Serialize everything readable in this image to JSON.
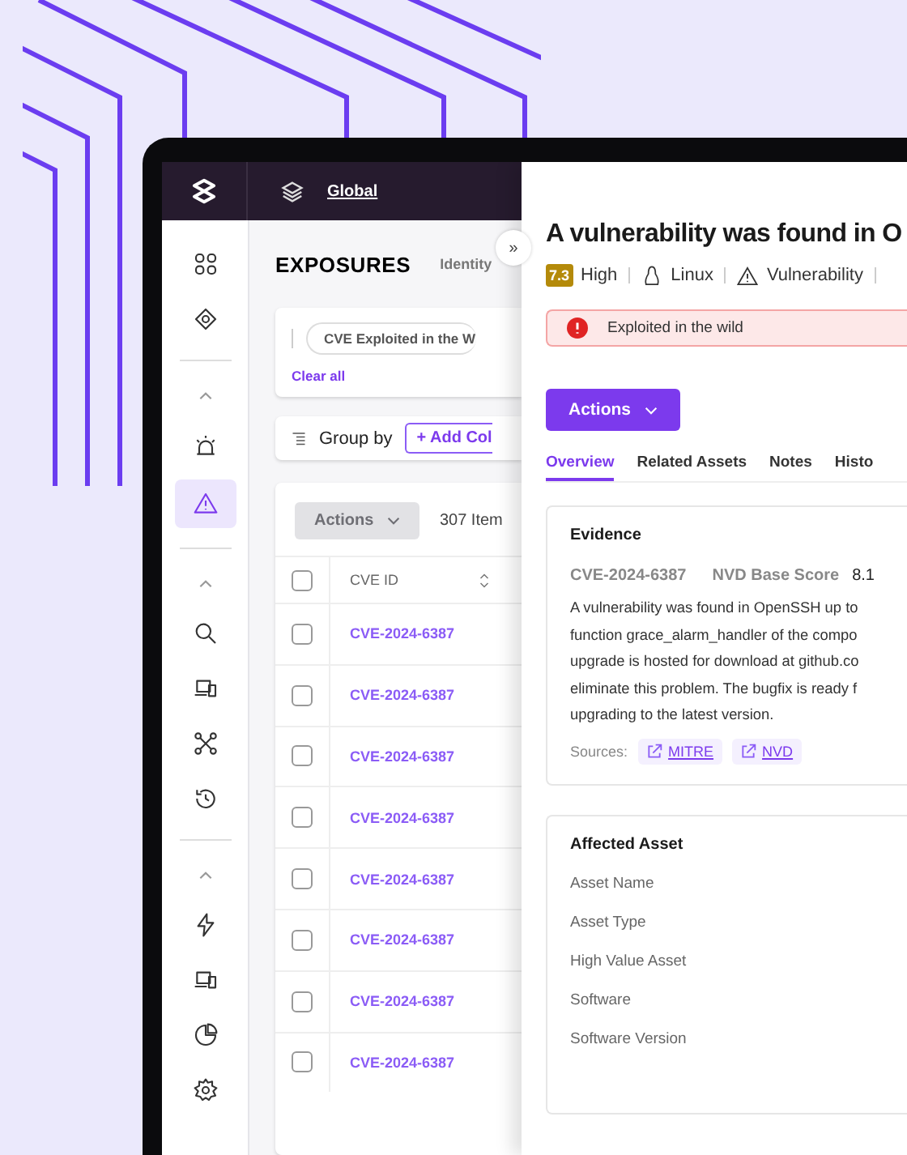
{
  "top_bar": {
    "scope": "Global"
  },
  "sidebar": {
    "sections": [
      {
        "items": [
          {
            "kind": "grid",
            "selected": false
          },
          {
            "kind": "drone",
            "selected": false
          }
        ]
      },
      {
        "expanded": true,
        "items": [
          {
            "kind": "alarm",
            "selected": false
          },
          {
            "kind": "warning",
            "selected": true
          }
        ]
      },
      {
        "expanded": true,
        "items": [
          {
            "kind": "search",
            "selected": false
          },
          {
            "kind": "devices",
            "selected": false
          },
          {
            "kind": "network",
            "selected": false
          },
          {
            "kind": "history",
            "selected": false
          }
        ]
      },
      {
        "expanded": true,
        "items": [
          {
            "kind": "bolt",
            "selected": false
          },
          {
            "kind": "devices",
            "selected": false
          },
          {
            "kind": "pie",
            "selected": false
          },
          {
            "kind": "gear",
            "selected": false
          }
        ]
      }
    ]
  },
  "header": {
    "title": "EXPOSURES",
    "tab": "Identity",
    "collapse": "»"
  },
  "filters": {
    "chips": [
      "CVE Exploited in the W"
    ],
    "clear": "Clear all"
  },
  "group_by": {
    "label": "Group by",
    "add": "+ Add Col"
  },
  "table": {
    "action": "Actions",
    "action_disabled": true,
    "count": "307 Item",
    "header_checked": false,
    "columns": [
      "CVE ID"
    ],
    "rows": [
      {
        "cve": "CVE-2024-6387",
        "checked": false
      },
      {
        "cve": "CVE-2024-6387",
        "checked": false
      },
      {
        "cve": "CVE-2024-6387",
        "checked": false
      },
      {
        "cve": "CVE-2024-6387",
        "checked": false
      },
      {
        "cve": "CVE-2024-6387",
        "checked": false
      },
      {
        "cve": "CVE-2024-6387",
        "checked": false
      },
      {
        "cve": "CVE-2024-6387",
        "checked": false
      },
      {
        "cve": "CVE-2024-6387",
        "checked": false
      }
    ]
  },
  "detail": {
    "title": "A vulnerability was found in O",
    "score": "7.3",
    "severity": "High",
    "meta": [
      {
        "kind": "os",
        "text": "Linux"
      },
      {
        "kind": "vulnerability",
        "text": "Vulnerability"
      }
    ],
    "alert": "Exploited in the wild",
    "action": "Actions",
    "tabs": [
      {
        "label": "Overview",
        "selected": true
      },
      {
        "label": "Related Assets",
        "selected": false
      },
      {
        "label": "Notes",
        "selected": false
      },
      {
        "label": "Histo",
        "selected": false
      }
    ],
    "evidence": {
      "title": "Evidence",
      "cve": "CVE-2024-6387",
      "score_label": "NVD Base Score",
      "score": "8.1",
      "lines": [
        "A vulnerability was found in OpenSSH up to",
        "function grace_alarm_handler of the compo",
        "upgrade is hosted for download at github.co",
        "eliminate this problem. The bugfix is ready f",
        "upgrading to the latest version."
      ],
      "sources_label": "Sources:",
      "sources": [
        "MITRE",
        "NVD"
      ]
    },
    "affected": {
      "title": "Affected Asset",
      "fields": [
        "Asset Name",
        "Asset Type",
        "High Value Asset",
        "Software",
        "Software Version"
      ]
    }
  }
}
